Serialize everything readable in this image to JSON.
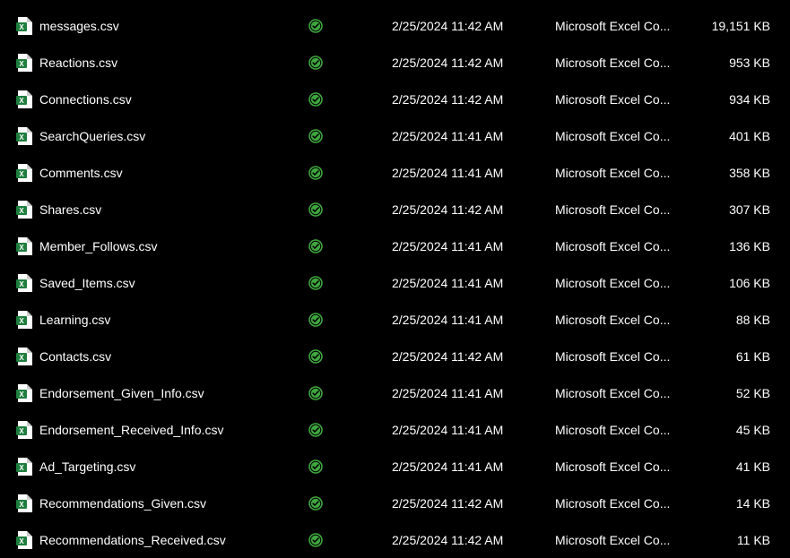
{
  "files": [
    {
      "name": "messages.csv",
      "modified": "2/25/2024 11:42 AM",
      "type": "Microsoft Excel Co...",
      "size": "19,151 KB"
    },
    {
      "name": "Reactions.csv",
      "modified": "2/25/2024 11:42 AM",
      "type": "Microsoft Excel Co...",
      "size": "953 KB"
    },
    {
      "name": "Connections.csv",
      "modified": "2/25/2024 11:42 AM",
      "type": "Microsoft Excel Co...",
      "size": "934 KB"
    },
    {
      "name": "SearchQueries.csv",
      "modified": "2/25/2024 11:41 AM",
      "type": "Microsoft Excel Co...",
      "size": "401 KB"
    },
    {
      "name": "Comments.csv",
      "modified": "2/25/2024 11:41 AM",
      "type": "Microsoft Excel Co...",
      "size": "358 KB"
    },
    {
      "name": "Shares.csv",
      "modified": "2/25/2024 11:42 AM",
      "type": "Microsoft Excel Co...",
      "size": "307 KB"
    },
    {
      "name": "Member_Follows.csv",
      "modified": "2/25/2024 11:41 AM",
      "type": "Microsoft Excel Co...",
      "size": "136 KB"
    },
    {
      "name": "Saved_Items.csv",
      "modified": "2/25/2024 11:41 AM",
      "type": "Microsoft Excel Co...",
      "size": "106 KB"
    },
    {
      "name": "Learning.csv",
      "modified": "2/25/2024 11:41 AM",
      "type": "Microsoft Excel Co...",
      "size": "88 KB"
    },
    {
      "name": "Contacts.csv",
      "modified": "2/25/2024 11:42 AM",
      "type": "Microsoft Excel Co...",
      "size": "61 KB"
    },
    {
      "name": "Endorsement_Given_Info.csv",
      "modified": "2/25/2024 11:41 AM",
      "type": "Microsoft Excel Co...",
      "size": "52 KB"
    },
    {
      "name": "Endorsement_Received_Info.csv",
      "modified": "2/25/2024 11:41 AM",
      "type": "Microsoft Excel Co...",
      "size": "45 KB"
    },
    {
      "name": "Ad_Targeting.csv",
      "modified": "2/25/2024 11:41 AM",
      "type": "Microsoft Excel Co...",
      "size": "41 KB"
    },
    {
      "name": "Recommendations_Given.csv",
      "modified": "2/25/2024 11:42 AM",
      "type": "Microsoft Excel Co...",
      "size": "14 KB"
    },
    {
      "name": "Recommendations_Received.csv",
      "modified": "2/25/2024 11:42 AM",
      "type": "Microsoft Excel Co...",
      "size": "11 KB"
    }
  ],
  "icons": {
    "excel_fill": "#1e7e3e",
    "excel_accent": "#ffffff",
    "status_ring": "#3fa63f",
    "status_check": "#3fa63f"
  }
}
